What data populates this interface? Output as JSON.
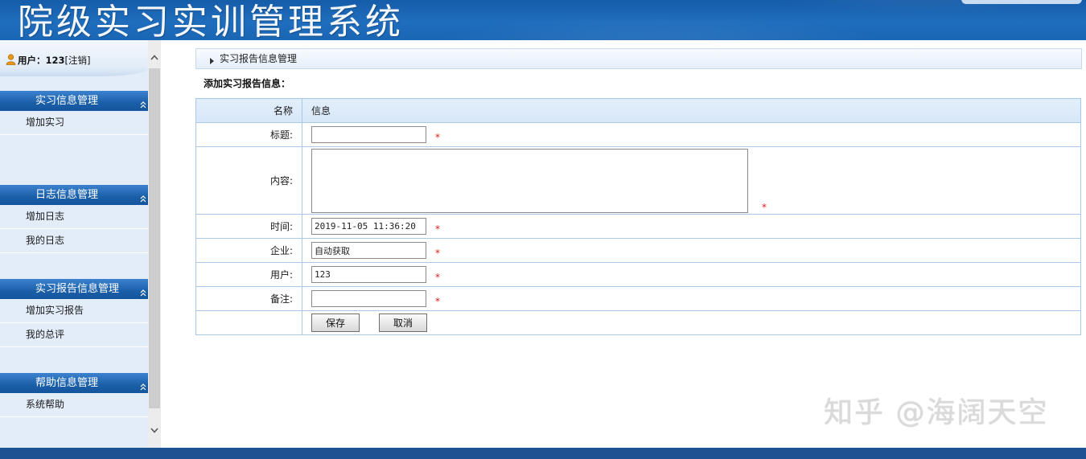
{
  "header": {
    "title": "院级实习实训管理系统"
  },
  "sidebar": {
    "user": {
      "label": "用户：",
      "name": "123",
      "logout": "[注销]"
    },
    "groups": [
      {
        "title": "实习信息管理",
        "items": [
          "增加实习"
        ]
      },
      {
        "title": "日志信息管理",
        "items": [
          "增加日志",
          "我的日志"
        ]
      },
      {
        "title": "实习报告信息管理",
        "items": [
          "增加实习报告",
          "我的总评"
        ]
      },
      {
        "title": "帮助信息管理",
        "items": [
          "系统帮助"
        ]
      }
    ]
  },
  "breadcrumb": {
    "text": "实习报告信息管理"
  },
  "form": {
    "heading": "添加实习报告信息：",
    "columns": {
      "name": "名称",
      "info": "信息"
    },
    "fields": {
      "title": {
        "label": "标题:",
        "value": ""
      },
      "content": {
        "label": "内容:",
        "value": ""
      },
      "time": {
        "label": "时间:",
        "value": "2019-11-05 11:36:20"
      },
      "company": {
        "label": "企业:",
        "value": "自动获取"
      },
      "user": {
        "label": "用户:",
        "value": "123"
      },
      "remark": {
        "label": "备注:",
        "value": ""
      }
    },
    "required_mark": "*",
    "buttons": {
      "save": "保存",
      "cancel": "取消"
    }
  },
  "watermark": "知乎 @海阔天空",
  "icons": {
    "user": "user-icon",
    "group_toggle": "double-chevron-up-icon",
    "breadcrumb": "triangle-right-icon",
    "scroll_up": "chevron-up-icon",
    "scroll_down": "chevron-down-icon"
  },
  "colors": {
    "header_blue": "#1f6dbd",
    "menu_blue": "#1b5fa9",
    "sidebar_bg": "#e3edf9",
    "table_border": "#a9c8ea",
    "table_head": "#d7e7f8",
    "required_red": "#e02020",
    "footer_blue": "#1c5292"
  }
}
